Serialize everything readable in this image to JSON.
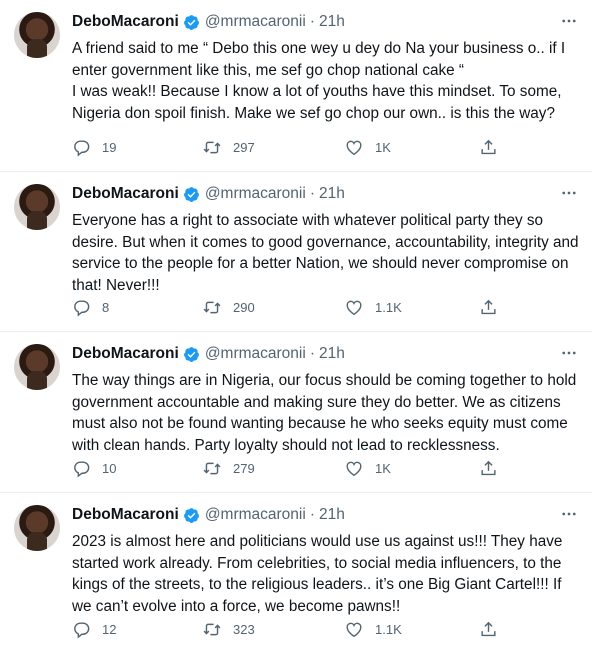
{
  "tweets": [
    {
      "name": "DeboMacaroni",
      "handle": "@mrmacaronii",
      "time": "21h",
      "text": "A friend said to me “ Debo this one wey u dey do Na your business o.. if I enter government like this, me sef go chop national cake “\nI was weak!! Because I know a lot of youths have this mindset. To some, Nigeria don spoil finish. Make we sef  go chop our own.. is this the way?",
      "replies": "19",
      "retweets": "297",
      "likes": "1K"
    },
    {
      "name": "DeboMacaroni",
      "handle": "@mrmacaronii",
      "time": "21h",
      "text": "Everyone has a right to associate with whatever political party they so desire. But when it comes to good governance, accountability, integrity and service to the people for a better Nation, we should never compromise on that! Never!!!",
      "replies": "8",
      "retweets": "290",
      "likes": "1.1K"
    },
    {
      "name": "DeboMacaroni",
      "handle": "@mrmacaronii",
      "time": "21h",
      "text": "The way things are in Nigeria, our focus should be coming together to hold government accountable and making sure they do better. We as citizens must also not be found wanting because he who seeks equity must come with clean hands. Party loyalty should not lead to recklessness.",
      "replies": "10",
      "retweets": "279",
      "likes": "1K"
    },
    {
      "name": "DeboMacaroni",
      "handle": "@mrmacaronii",
      "time": "21h",
      "text": "2023 is almost here and politicians would use us against us!!! They have started work already. From celebrities, to social media influencers, to the kings of the streets, to the religious leaders.. it’s one Big Giant Cartel!!! If we can’t evolve into a force, we become pawns!!",
      "replies": "12",
      "retweets": "323",
      "likes": "1.1K"
    }
  ],
  "separator": "·",
  "icons": {
    "verified": "verified-badge-icon",
    "more": "more-dots-icon",
    "reply": "reply-icon",
    "retweet": "retweet-icon",
    "like": "heart-icon",
    "share": "share-icon"
  },
  "colors": {
    "verified": "#1d9bf0",
    "muted": "#536471",
    "text": "#0f1419"
  }
}
